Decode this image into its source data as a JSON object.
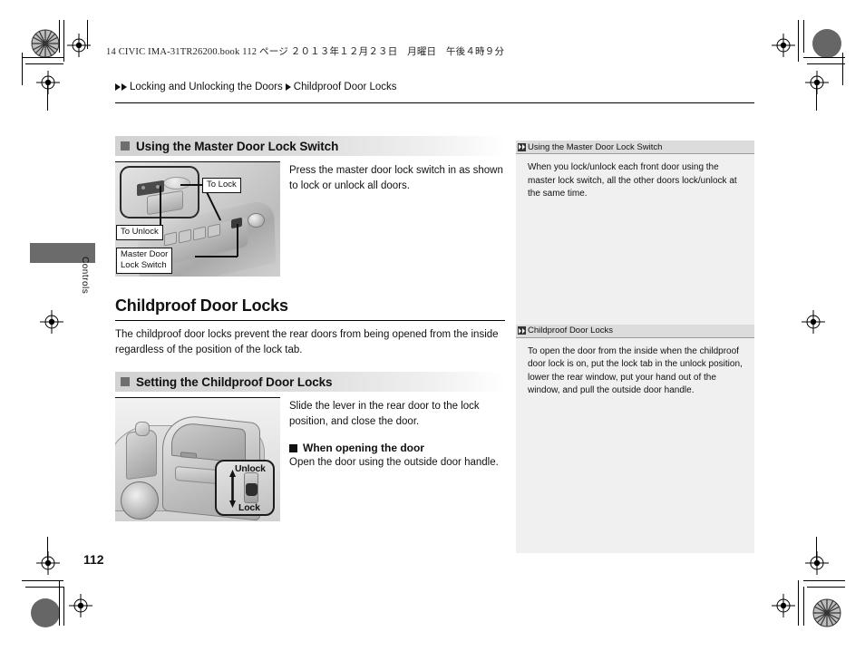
{
  "document": {
    "file_header": "14 CIVIC IMA-31TR26200.book   112 ページ   ２０１３年１２月２３日　月曜日　午後４時９分",
    "page_number": "112",
    "side_tab_label": "Controls"
  },
  "breadcrumb": {
    "parent": "Locking and Unlocking the Doors",
    "current": "Childproof Door Locks"
  },
  "sections": {
    "master_switch": {
      "heading": "Using the Master Door Lock Switch",
      "body": "Press the master door lock switch in as shown to lock or unlock all doors.",
      "figure_labels": {
        "to_lock": "To Lock",
        "to_unlock": "To Unlock",
        "master_door_lock_switch": "Master Door\nLock Switch"
      }
    },
    "childproof": {
      "title": "Childproof Door Locks",
      "intro": "The childproof door locks prevent the rear doors from being opened from the inside regardless of the position of the lock tab.",
      "setting_heading": "Setting the Childproof Door Locks",
      "setting_body": "Slide the lever in the rear door to the lock position, and close the door.",
      "subheading": "When opening the door",
      "sub_body": "Open the door using the outside door handle.",
      "figure_labels": {
        "unlock": "Unlock",
        "lock": "Lock"
      }
    }
  },
  "sidebar": {
    "notes": [
      {
        "title": "Using the Master Door Lock Switch",
        "text": "When you lock/unlock each front door using the master lock switch, all the other doors lock/unlock at the same time."
      },
      {
        "title": "Childproof Door Locks",
        "text": "To open the door from the inside when the childproof door lock is on, put the lock tab in the unlock position, lower the rear window, put your hand out of the window, and pull the outside door handle."
      }
    ]
  },
  "colors": {
    "section_bar": "#d2d2d2",
    "sidebar_bg": "#f0f0f0",
    "sidebar_head": "#dcdcdc",
    "tab_block": "#6b6b6b",
    "text": "#111111"
  }
}
